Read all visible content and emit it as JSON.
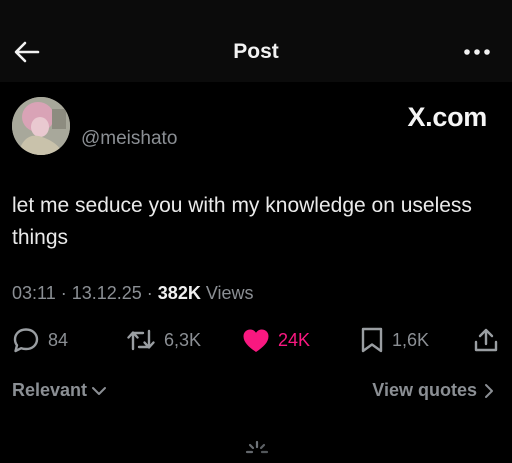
{
  "header": {
    "title": "Post",
    "back_icon": "arrow-left-icon",
    "more_icon": "more-horizontal-icon"
  },
  "author": {
    "handle": "@meishato",
    "avatar_icon": "avatar"
  },
  "watermark": "X.com",
  "post": {
    "text": "let me seduce you with my knowledge on useless things"
  },
  "meta": {
    "time": "03:11",
    "sep1": " · ",
    "date": "13.12.25",
    "sep2": " · ",
    "views_count": "382K",
    "views_label": " Views"
  },
  "actions": {
    "replies": "84",
    "reposts": "6,3K",
    "likes": "24K",
    "bookmarks": "1,6K",
    "like_color": "#f91880"
  },
  "footer": {
    "sort_label": "Relevant",
    "quotes_label": "View quotes"
  }
}
